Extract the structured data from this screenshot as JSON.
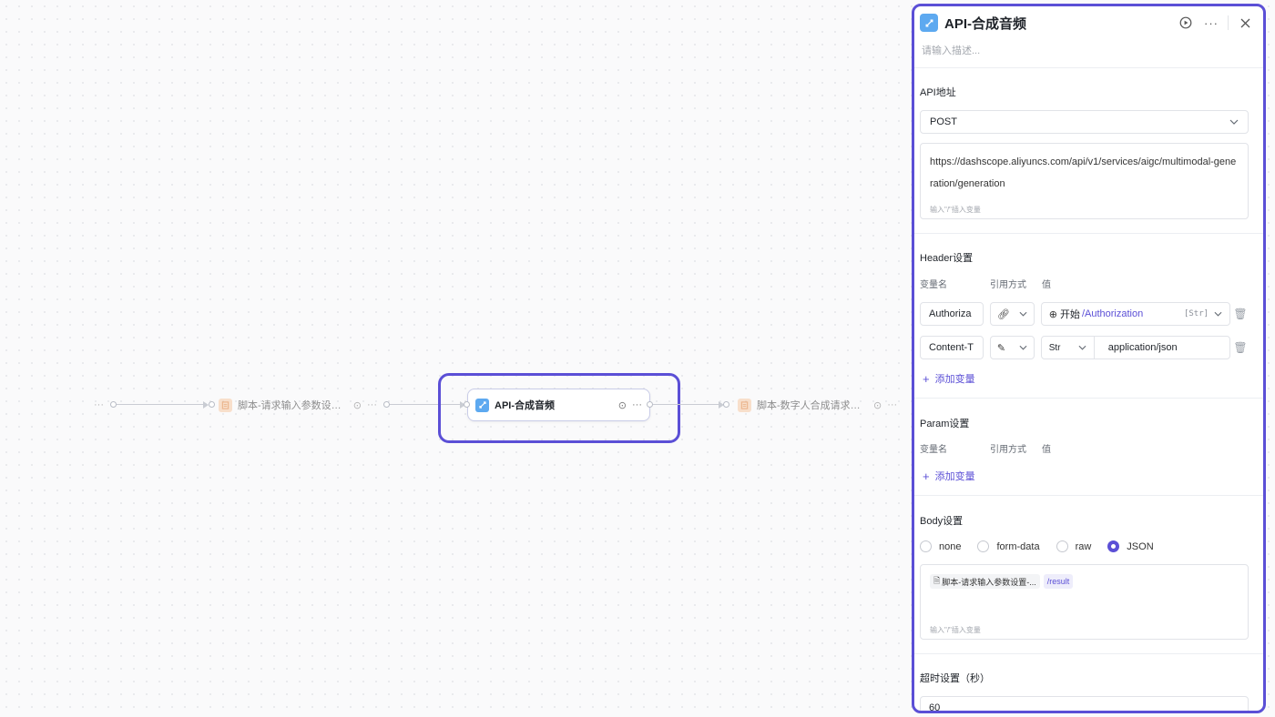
{
  "canvas": {
    "nodes": [
      {
        "title": "",
        "more": "···"
      },
      {
        "title": "脚本-请求输入参数设置-音...",
        "more": "···"
      },
      {
        "title": "API-合成音频",
        "more": "···"
      },
      {
        "title": "脚本-数字人合成请求参数",
        "more": "···"
      }
    ]
  },
  "panel": {
    "title": "API-合成音频",
    "description_placeholder": "请输入描述...",
    "api_section": {
      "label": "API地址",
      "method": "POST",
      "url": "https://dashscope.aliyuncs.com/api/v1/services/aigc/multimodal-generation/generation",
      "hint": "输入\"/\"插入变量"
    },
    "header_section": {
      "label": "Header设置",
      "col_name": "变量名",
      "col_ref": "引用方式",
      "col_value": "值",
      "rows": [
        {
          "name": "Authoriza",
          "ref_icon": "link-icon",
          "value_prefix": "开始",
          "value_path": "/Authorization",
          "value_type": "[Str]"
        },
        {
          "name": "Content-T",
          "ref_icon": "pencil-icon",
          "type": "Str",
          "value": "application/json"
        }
      ],
      "add_label": "添加变量"
    },
    "param_section": {
      "label": "Param设置",
      "col_name": "变量名",
      "col_ref": "引用方式",
      "col_value": "值",
      "add_label": "添加变量"
    },
    "body_section": {
      "label": "Body设置",
      "options": [
        "none",
        "form-data",
        "raw",
        "JSON"
      ],
      "selected": "JSON",
      "chip_text": "脚本-请求输入参数设置-...",
      "chip_path": "/result",
      "hint": "输入\"/\"插入变量"
    },
    "timeout_section": {
      "label": "超时设置（秒）",
      "value": "60"
    }
  },
  "colors": {
    "accent": "#5b4fd6",
    "node_icon_blue": "#5da9f0",
    "node_icon_orange": "#f7c9a4"
  }
}
